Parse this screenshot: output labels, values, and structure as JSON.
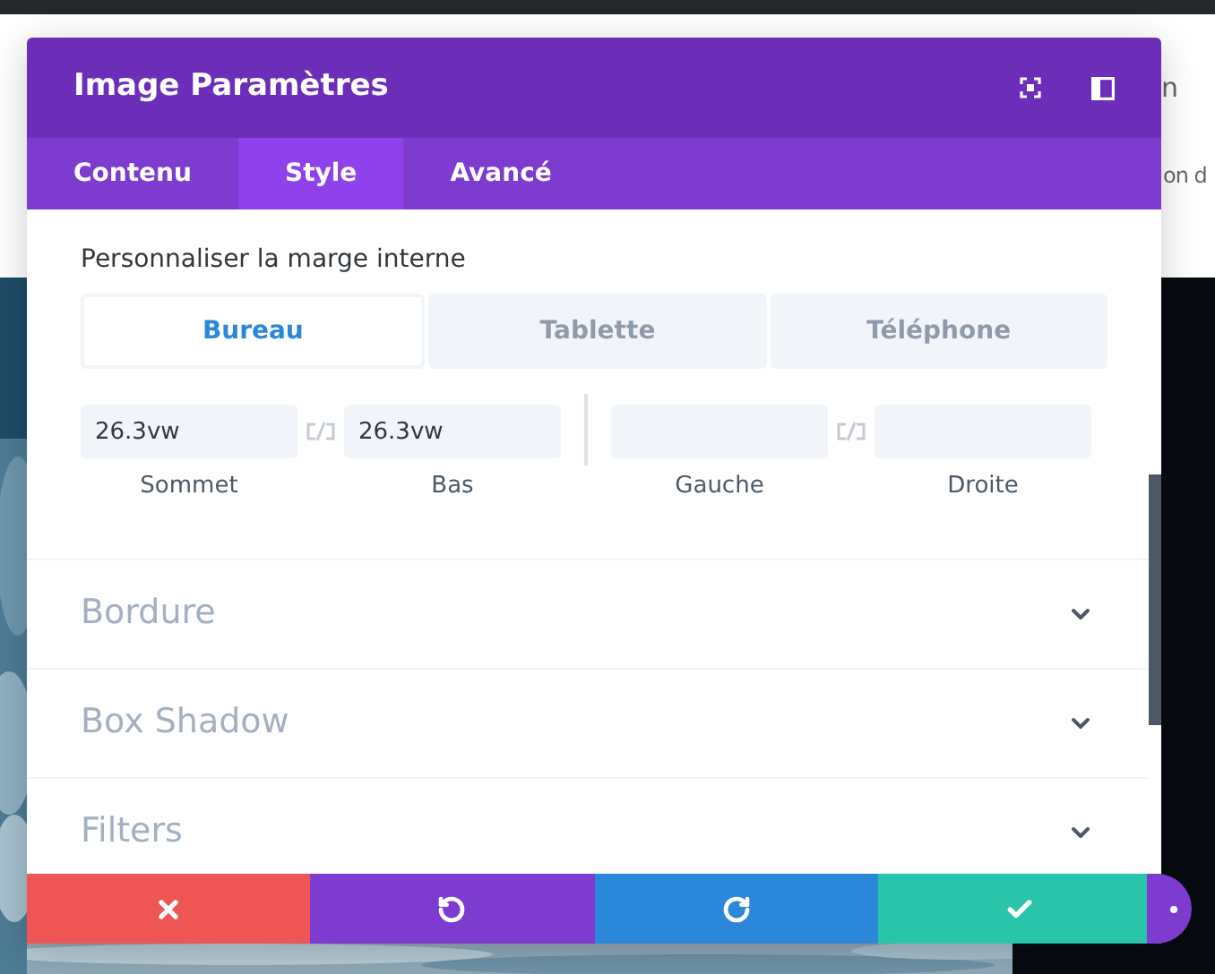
{
  "background_text": [
    "n",
    "on d"
  ],
  "window": {
    "title": "Image Paramètres"
  },
  "tabs": [
    {
      "label": "Contenu",
      "selected": false
    },
    {
      "label": "Style",
      "selected": true
    },
    {
      "label": "Avancé",
      "selected": false
    }
  ],
  "padding": {
    "label": "Personnaliser la marge interne",
    "devices": [
      {
        "label": "Bureau",
        "selected": true
      },
      {
        "label": "Tablette",
        "selected": false
      },
      {
        "label": "Téléphone",
        "selected": false
      }
    ],
    "pairs": [
      [
        {
          "label": "Sommet",
          "value": "26.3vw"
        },
        {
          "label": "Bas",
          "value": "26.3vw"
        }
      ],
      [
        {
          "label": "Gauche"
        },
        {
          "label": "Droite"
        }
      ]
    ]
  },
  "sections": [
    {
      "title": "Bordure",
      "expanded": false
    },
    {
      "title": "Box Shadow",
      "expanded": false
    },
    {
      "title": "Filters",
      "expanded": false
    }
  ],
  "footer": [
    {
      "kind": "cancel"
    },
    {
      "kind": "undo"
    },
    {
      "kind": "redo"
    },
    {
      "kind": "save"
    }
  ]
}
